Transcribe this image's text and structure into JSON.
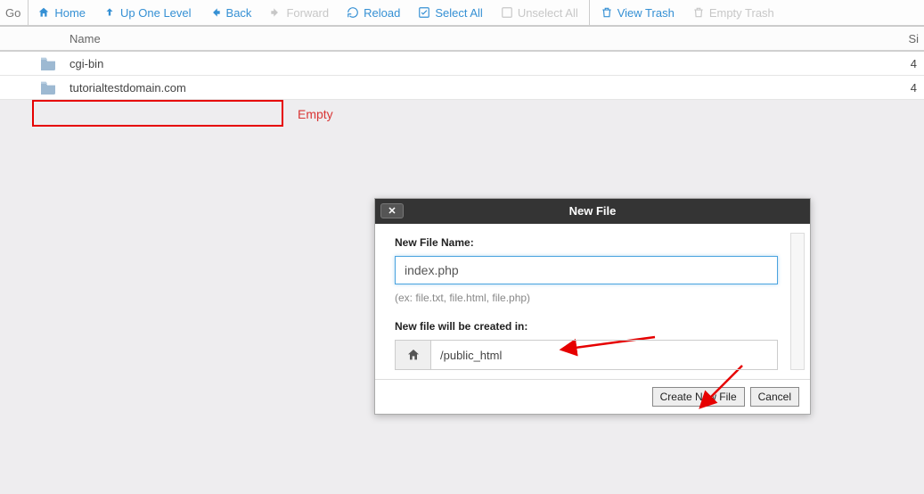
{
  "toolbar": {
    "go_label": "Go",
    "home": "Home",
    "up_one_level": "Up One Level",
    "back": "Back",
    "forward": "Forward",
    "reload": "Reload",
    "select_all": "Select All",
    "unselect_all": "Unselect All",
    "view_trash": "View Trash",
    "empty_trash": "Empty Trash"
  },
  "table": {
    "headers": {
      "name": "Name",
      "size": "Si"
    },
    "rows": [
      {
        "name": "cgi-bin",
        "size": "4"
      },
      {
        "name": "tutorialtestdomain.com",
        "size": "4"
      }
    ]
  },
  "annotation": {
    "empty_label": "Empty"
  },
  "dialog": {
    "title": "New File",
    "filename_label": "New File Name:",
    "filename_value": "index.php",
    "filename_hint": "(ex: file.txt, file.html, file.php)",
    "location_label": "New file will be created in:",
    "location_path": "/public_html",
    "create_button": "Create New File",
    "cancel_button": "Cancel"
  }
}
